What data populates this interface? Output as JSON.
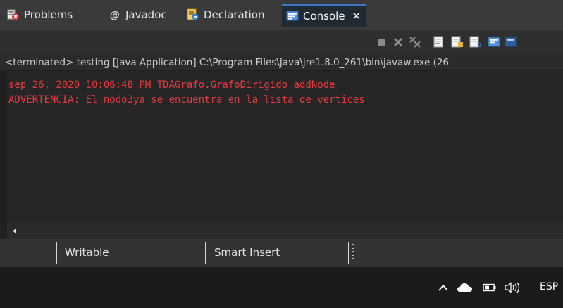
{
  "tabs": [
    {
      "label": "Problems",
      "icon": "problems-icon"
    },
    {
      "label": "Javadoc",
      "icon": "javadoc-icon"
    },
    {
      "label": "Declaration",
      "icon": "declaration-icon"
    },
    {
      "label": "Console",
      "icon": "console-icon",
      "active": true
    }
  ],
  "console": {
    "status": "<terminated> testing [Java Application] C:\\Program Files\\Java\\jre1.8.0_261\\bin\\javaw.exe  (26",
    "lines": [
      "sep 26, 2020 10:06:48 PM TDAGrafo.GrafoDirigido addNode",
      "ADVERTENCIA: El nodo3ya se encuentra en la lista de vertices"
    ],
    "text_color": "#e8393f"
  },
  "statusbar": {
    "writable": "Writable",
    "insert_mode": "Smart Insert"
  },
  "taskbar": {
    "language": "ESP"
  },
  "colors": {
    "accent": "#3b79c4",
    "tab_bar": "#3a3a3a",
    "console_bg": "#262626"
  }
}
